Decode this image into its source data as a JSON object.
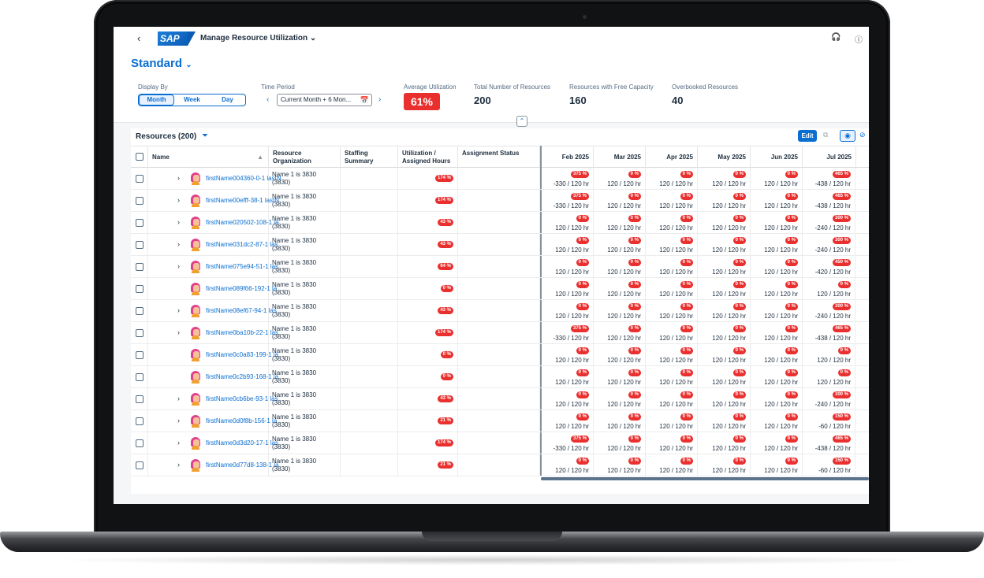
{
  "shell": {
    "back_icon": "chevron-left-icon",
    "logo_text": "SAP",
    "app_title": "Manage Resource Utilization",
    "title_icon": "chevron-down-icon",
    "support_icon": "headset-icon",
    "help_icon": "help-icon"
  },
  "header": {
    "variant": "Standard",
    "display_by": {
      "label": "Display By",
      "options": [
        "Month",
        "Week",
        "Day"
      ],
      "selected": "Month"
    },
    "time_period": {
      "label": "Time Period",
      "value": "Current Month + 6 Mon..."
    },
    "kpis": {
      "avg_label": "Average Utilization",
      "avg_value": "61%",
      "avg_color": "#e9302f",
      "total_label": "Total Number of Resources",
      "total_value": "200",
      "free_label": "Resources with Free Capacity",
      "free_value": "160",
      "over_label": "Overbooked Resources",
      "over_value": "40"
    }
  },
  "table": {
    "title": "Resources (200)",
    "edit_label": "Edit",
    "columns": {
      "name": "Name",
      "org": "Resource Organization",
      "staffing": "Staffing Summary",
      "util": "Utilization / Assigned Hours",
      "status": "Assignment Status"
    },
    "months": [
      "Feb 2025",
      "Mar 2025",
      "Apr 2025",
      "May 2025",
      "Jun 2025",
      "Jul 2025"
    ],
    "rows": [
      {
        "name": "firstName004360-0-1 lastN",
        "org": "Name 1 is 3830",
        "org2": "(3830)",
        "util": "174 %",
        "expand": true,
        "m": [
          [
            "375 %",
            "-330 / 120 hr"
          ],
          [
            "0 %",
            "120 / 120 hr"
          ],
          [
            "0 %",
            "120 / 120 hr"
          ],
          [
            "0 %",
            "120 / 120 hr"
          ],
          [
            "0 %",
            "120 / 120 hr"
          ],
          [
            "465 %",
            "-438 / 120 hr"
          ]
        ]
      },
      {
        "name": "firstName00efff-38-1 lastN",
        "org": "Name 1 is 3830",
        "org2": "(3830)",
        "util": "174 %",
        "expand": true,
        "m": [
          [
            "375 %",
            "-330 / 120 hr"
          ],
          [
            "0 %",
            "120 / 120 hr"
          ],
          [
            "0 %",
            "120 / 120 hr"
          ],
          [
            "0 %",
            "120 / 120 hr"
          ],
          [
            "0 %",
            "120 / 120 hr"
          ],
          [
            "465 %",
            "-438 / 120 hr"
          ]
        ]
      },
      {
        "name": "firstName020502-108-1 la",
        "org": "Name 1 is 3830",
        "org2": "(3830)",
        "util": "43 %",
        "expand": true,
        "m": [
          [
            "0 %",
            "120 / 120 hr"
          ],
          [
            "0 %",
            "120 / 120 hr"
          ],
          [
            "0 %",
            "120 / 120 hr"
          ],
          [
            "0 %",
            "120 / 120 hr"
          ],
          [
            "0 %",
            "120 / 120 hr"
          ],
          [
            "300 %",
            "-240 / 120 hr"
          ]
        ]
      },
      {
        "name": "firstName031dc2-87-1 las",
        "org": "Name 1 is 3830",
        "org2": "(3830)",
        "util": "43 %",
        "expand": true,
        "m": [
          [
            "0 %",
            "120 / 120 hr"
          ],
          [
            "0 %",
            "120 / 120 hr"
          ],
          [
            "0 %",
            "120 / 120 hr"
          ],
          [
            "0 %",
            "120 / 120 hr"
          ],
          [
            "0 %",
            "120 / 120 hr"
          ],
          [
            "300 %",
            "-240 / 120 hr"
          ]
        ]
      },
      {
        "name": "firstName075e94-51-1 las",
        "org": "Name 1 is 3830",
        "org2": "(3830)",
        "util": "64 %",
        "expand": true,
        "m": [
          [
            "0 %",
            "120 / 120 hr"
          ],
          [
            "0 %",
            "120 / 120 hr"
          ],
          [
            "0 %",
            "120 / 120 hr"
          ],
          [
            "0 %",
            "120 / 120 hr"
          ],
          [
            "0 %",
            "120 / 120 hr"
          ],
          [
            "450 %",
            "-420 / 120 hr"
          ]
        ]
      },
      {
        "name": "firstName089f66-192-1 la",
        "org": "Name 1 is 3830",
        "org2": "(3830)",
        "util": "0 %",
        "expand": false,
        "m": [
          [
            "0 %",
            "120 / 120 hr"
          ],
          [
            "0 %",
            "120 / 120 hr"
          ],
          [
            "0 %",
            "120 / 120 hr"
          ],
          [
            "0 %",
            "120 / 120 hr"
          ],
          [
            "0 %",
            "120 / 120 hr"
          ],
          [
            "0 %",
            "120 / 120 hr"
          ]
        ]
      },
      {
        "name": "firstName08ef67-94-1 las",
        "org": "Name 1 is 3830",
        "org2": "(3830)",
        "util": "43 %",
        "expand": true,
        "m": [
          [
            "0 %",
            "120 / 120 hr"
          ],
          [
            "0 %",
            "120 / 120 hr"
          ],
          [
            "0 %",
            "120 / 120 hr"
          ],
          [
            "0 %",
            "120 / 120 hr"
          ],
          [
            "0 %",
            "120 / 120 hr"
          ],
          [
            "300 %",
            "-240 / 120 hr"
          ]
        ]
      },
      {
        "name": "firstName0ba10b-22-1 las",
        "org": "Name 1 is 3830",
        "org2": "(3830)",
        "util": "174 %",
        "expand": true,
        "m": [
          [
            "375 %",
            "-330 / 120 hr"
          ],
          [
            "0 %",
            "120 / 120 hr"
          ],
          [
            "0 %",
            "120 / 120 hr"
          ],
          [
            "0 %",
            "120 / 120 hr"
          ],
          [
            "0 %",
            "120 / 120 hr"
          ],
          [
            "465 %",
            "-438 / 120 hr"
          ]
        ]
      },
      {
        "name": "firstName0c0a83-199-1 la",
        "org": "Name 1 is 3830",
        "org2": "(3830)",
        "util": "0 %",
        "expand": false,
        "m": [
          [
            "0 %",
            "120 / 120 hr"
          ],
          [
            "0 %",
            "120 / 120 hr"
          ],
          [
            "0 %",
            "120 / 120 hr"
          ],
          [
            "0 %",
            "120 / 120 hr"
          ],
          [
            "0 %",
            "120 / 120 hr"
          ],
          [
            "0 %",
            "120 / 120 hr"
          ]
        ]
      },
      {
        "name": "firstName0c2b93-168-1 la",
        "org": "Name 1 is 3830",
        "org2": "(3830)",
        "util": "0 %",
        "expand": false,
        "m": [
          [
            "0 %",
            "120 / 120 hr"
          ],
          [
            "0 %",
            "120 / 120 hr"
          ],
          [
            "0 %",
            "120 / 120 hr"
          ],
          [
            "0 %",
            "120 / 120 hr"
          ],
          [
            "0 %",
            "120 / 120 hr"
          ],
          [
            "0 %",
            "120 / 120 hr"
          ]
        ]
      },
      {
        "name": "firstName0cb6be-93-1 las",
        "org": "Name 1 is 3830",
        "org2": "(3830)",
        "util": "43 %",
        "expand": true,
        "m": [
          [
            "0 %",
            "120 / 120 hr"
          ],
          [
            "0 %",
            "120 / 120 hr"
          ],
          [
            "0 %",
            "120 / 120 hr"
          ],
          [
            "0 %",
            "120 / 120 hr"
          ],
          [
            "0 %",
            "120 / 120 hr"
          ],
          [
            "300 %",
            "-240 / 120 hr"
          ]
        ]
      },
      {
        "name": "firstName0d0f8b-156-1 la",
        "org": "Name 1 is 3830",
        "org2": "(3830)",
        "util": "21 %",
        "expand": true,
        "m": [
          [
            "0 %",
            "120 / 120 hr"
          ],
          [
            "0 %",
            "120 / 120 hr"
          ],
          [
            "0 %",
            "120 / 120 hr"
          ],
          [
            "0 %",
            "120 / 120 hr"
          ],
          [
            "0 %",
            "120 / 120 hr"
          ],
          [
            "150 %",
            "-60 / 120 hr"
          ]
        ]
      },
      {
        "name": "firstName0d3d20-17-1 las",
        "org": "Name 1 is 3830",
        "org2": "(3830)",
        "util": "174 %",
        "expand": true,
        "m": [
          [
            "375 %",
            "-330 / 120 hr"
          ],
          [
            "0 %",
            "120 / 120 hr"
          ],
          [
            "0 %",
            "120 / 120 hr"
          ],
          [
            "0 %",
            "120 / 120 hr"
          ],
          [
            "0 %",
            "120 / 120 hr"
          ],
          [
            "465 %",
            "-438 / 120 hr"
          ]
        ]
      },
      {
        "name": "firstName0d77d8-138-1 la",
        "org": "Name 1 is 3830",
        "org2": "(3830)",
        "util": "21 %",
        "expand": true,
        "m": [
          [
            "0 %",
            "120 / 120 hr"
          ],
          [
            "0 %",
            "120 / 120 hr"
          ],
          [
            "0 %",
            "120 / 120 hr"
          ],
          [
            "0 %",
            "120 / 120 hr"
          ],
          [
            "0 %",
            "120 / 120 hr"
          ],
          [
            "150 %",
            "-60 / 120 hr"
          ]
        ]
      }
    ]
  }
}
